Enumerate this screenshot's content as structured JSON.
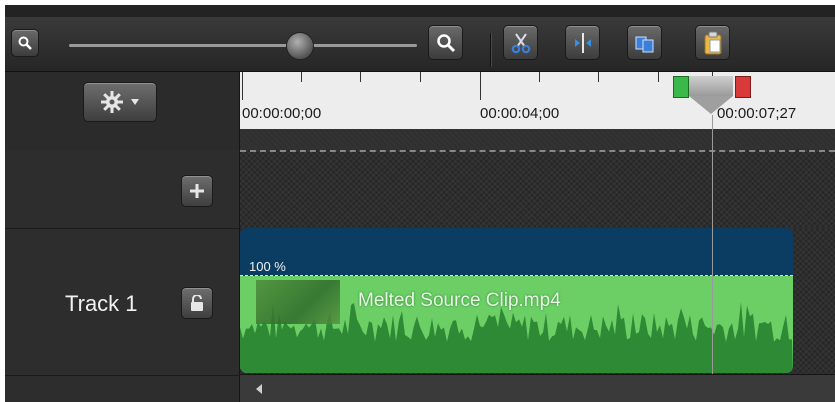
{
  "toolbar": {
    "zoom_out_icon": "magnifier-minus",
    "zoom_in_icon": "magnifier-plus",
    "zoom_level": 0.66,
    "buttons": [
      "scissors",
      "split",
      "copy",
      "paste"
    ]
  },
  "ruler": {
    "timecodes": [
      "00:00:00;00",
      "00:00:04;00",
      "00:00:07;27"
    ]
  },
  "tracks": [
    {
      "label": "Track 1",
      "clip": {
        "speed": "100 %",
        "name": "Melted Source Clip.mp4"
      }
    }
  ],
  "colors": {
    "clip_header": "#0b3c61",
    "clip_audio": "#6bcf66",
    "waveform": "#2e8a34"
  }
}
